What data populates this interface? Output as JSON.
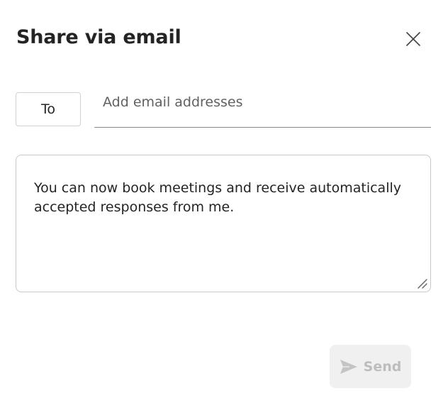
{
  "dialog": {
    "title": "Share via email",
    "close_icon": "close-icon",
    "to_button_label": "To",
    "email_input": {
      "value": "",
      "placeholder": "Add email addresses"
    },
    "message": {
      "text": "You can now book meetings and receive automatically accepted responses from me."
    },
    "send_button": {
      "label": "Send",
      "icon": "send-icon",
      "state": "disabled"
    }
  },
  "colors": {
    "text": "#242424",
    "placeholder": "#616161",
    "border": "#d1d1d1",
    "disabled_bg": "#f0f0f0",
    "disabled_text": "#bdbdbd"
  }
}
